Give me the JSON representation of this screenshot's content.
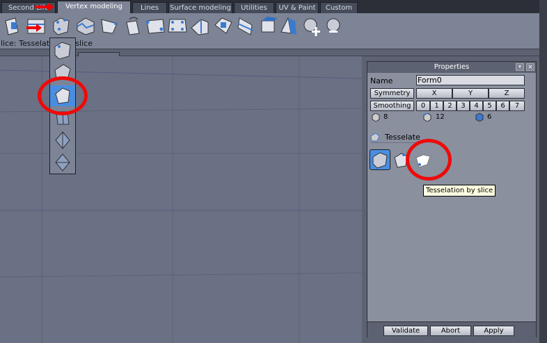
{
  "tabs": [
    {
      "label": "Second Life"
    },
    {
      "label": "Vertex modeling",
      "active": true
    },
    {
      "label": "Lines"
    },
    {
      "label": "Surface modeling"
    },
    {
      "label": "Utilities"
    },
    {
      "label": "UV & Paint"
    },
    {
      "label": "Custom"
    }
  ],
  "status": {
    "text": "lice: Tesselation by slice"
  },
  "properties": {
    "title": "Properties",
    "name_label": "Name",
    "name_value": "Form0",
    "symmetry_label": "Symmetry",
    "symmetry_axes": [
      "X",
      "Y",
      "Z"
    ],
    "smoothing_label": "Smoothing",
    "smoothing_levels": [
      "0",
      "1",
      "2",
      "3",
      "4",
      "5",
      "6",
      "7"
    ],
    "counts": {
      "vertices": "8",
      "edges": "12",
      "faces": "6"
    },
    "section_label": "Tesselate",
    "tooltip": "Tesselation by slice",
    "buttons": {
      "validate": "Validate",
      "abort": "Abort",
      "apply": "Apply"
    }
  },
  "colors": {
    "accent": "#4a8de0",
    "annotation": "#ee0a0a"
  }
}
